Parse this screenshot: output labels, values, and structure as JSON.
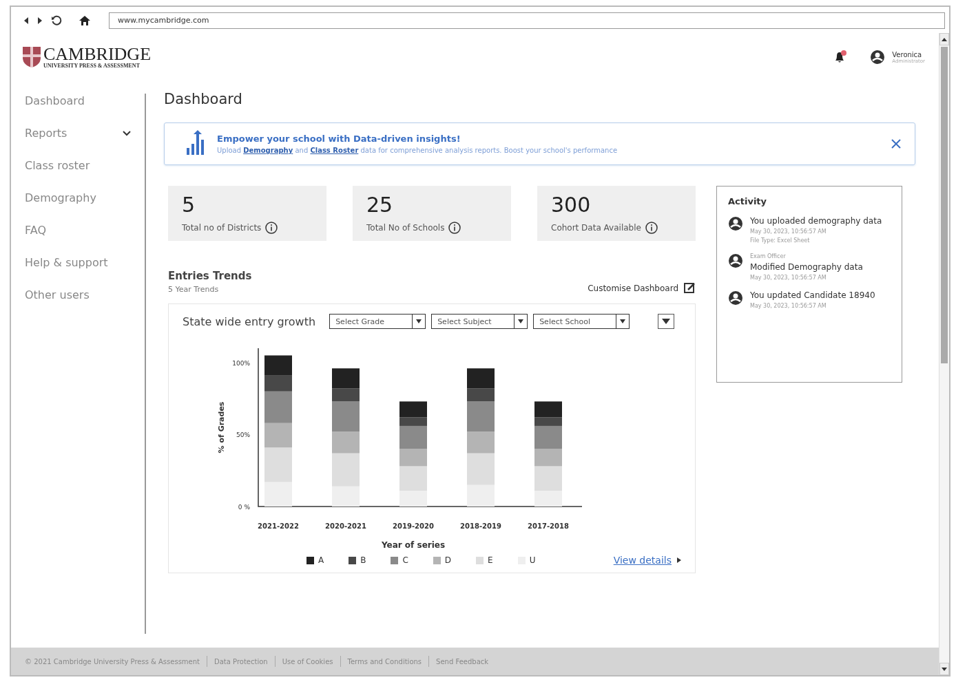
{
  "browser": {
    "url": "www.mycambridge.com"
  },
  "header": {
    "logo_title": "CAMBRIDGE",
    "logo_subtitle": "UNIVERSITY PRESS & ASSESSMENT",
    "notification": true,
    "user_name": "Veronica",
    "user_role": "Administrator"
  },
  "sidebar": {
    "items": [
      {
        "label": "Dashboard",
        "expandable": false
      },
      {
        "label": "Reports",
        "expandable": true
      },
      {
        "label": "Class roster",
        "expandable": false
      },
      {
        "label": "Demography",
        "expandable": false
      },
      {
        "label": "FAQ",
        "expandable": false
      },
      {
        "label": "Help & support",
        "expandable": false
      },
      {
        "label": "Other users",
        "expandable": false
      }
    ]
  },
  "page_title": "Dashboard",
  "banner": {
    "title": "Empower your school with Data-driven insights!",
    "parts": [
      {
        "kind": "text",
        "text": "Upload "
      },
      {
        "kind": "link",
        "text": "Demography"
      },
      {
        "kind": "text",
        "text": " and "
      },
      {
        "kind": "link",
        "text": "Class Roster"
      },
      {
        "kind": "text",
        "text": " data for comprehensive analysis reports. Boost your school's performance"
      }
    ]
  },
  "stats": [
    {
      "value": "5",
      "label": "Total no of Districts"
    },
    {
      "value": "25",
      "label": "Total No of Schools"
    },
    {
      "value": "300",
      "label": "Cohort Data Available"
    }
  ],
  "trends": {
    "title": "Entries Trends",
    "subtitle": "5 Year Trends",
    "customise": "Customise Dashboard",
    "chart_title": "State wide entry growth",
    "filters": [
      {
        "placeholder": "Select Grade"
      },
      {
        "placeholder": "Select Subject"
      },
      {
        "placeholder": "Select School"
      }
    ],
    "chart_data": {
      "type": "bar",
      "stacked": true,
      "xlabel": "Year of series",
      "ylabel": "% of Grades",
      "categories": [
        "2021-2022",
        "2020-2021",
        "2019-2020",
        "2018-2019",
        "2017-2018"
      ],
      "ylim": [
        0,
        110
      ],
      "yticks": [
        {
          "value": 0,
          "label": "0 %"
        },
        {
          "value": 50,
          "label": "50%"
        },
        {
          "value": 100,
          "label": "100%"
        }
      ],
      "series": [
        {
          "name": "A",
          "color": "#222222",
          "values": [
            14,
            14,
            11,
            14,
            11
          ]
        },
        {
          "name": "B",
          "color": "#484848",
          "values": [
            11,
            9,
            6,
            9,
            6
          ]
        },
        {
          "name": "C",
          "color": "#8a8a8a",
          "values": [
            22,
            21,
            16,
            21,
            16
          ]
        },
        {
          "name": "D",
          "color": "#b4b4b4",
          "values": [
            17,
            15,
            12,
            15,
            12
          ]
        },
        {
          "name": "E",
          "color": "#dedede",
          "values": [
            24,
            23,
            17,
            22,
            17
          ]
        },
        {
          "name": "U",
          "color": "#efefef",
          "values": [
            17,
            14,
            11,
            15,
            11
          ]
        }
      ]
    },
    "view_details": "View details"
  },
  "activity": {
    "title": "Activity",
    "items": [
      {
        "text": "You uploaded demography data",
        "time": "May 30, 2023, 10:56:57 AM",
        "detail": "File Type: Excel Sheet"
      },
      {
        "actor": "Exam Officer",
        "text": "Modified Demography data",
        "time": "May 30, 2023, 10:56:57 AM"
      },
      {
        "text": "You updated Candidate 18940",
        "time": "May 30, 2023, 10:56:57 AM"
      }
    ]
  },
  "footer": [
    "© 2021 Cambridge University Press & Assessment",
    "Data Protection",
    "Use of Cookies",
    "Terms and Conditions",
    "Send Feedback"
  ]
}
